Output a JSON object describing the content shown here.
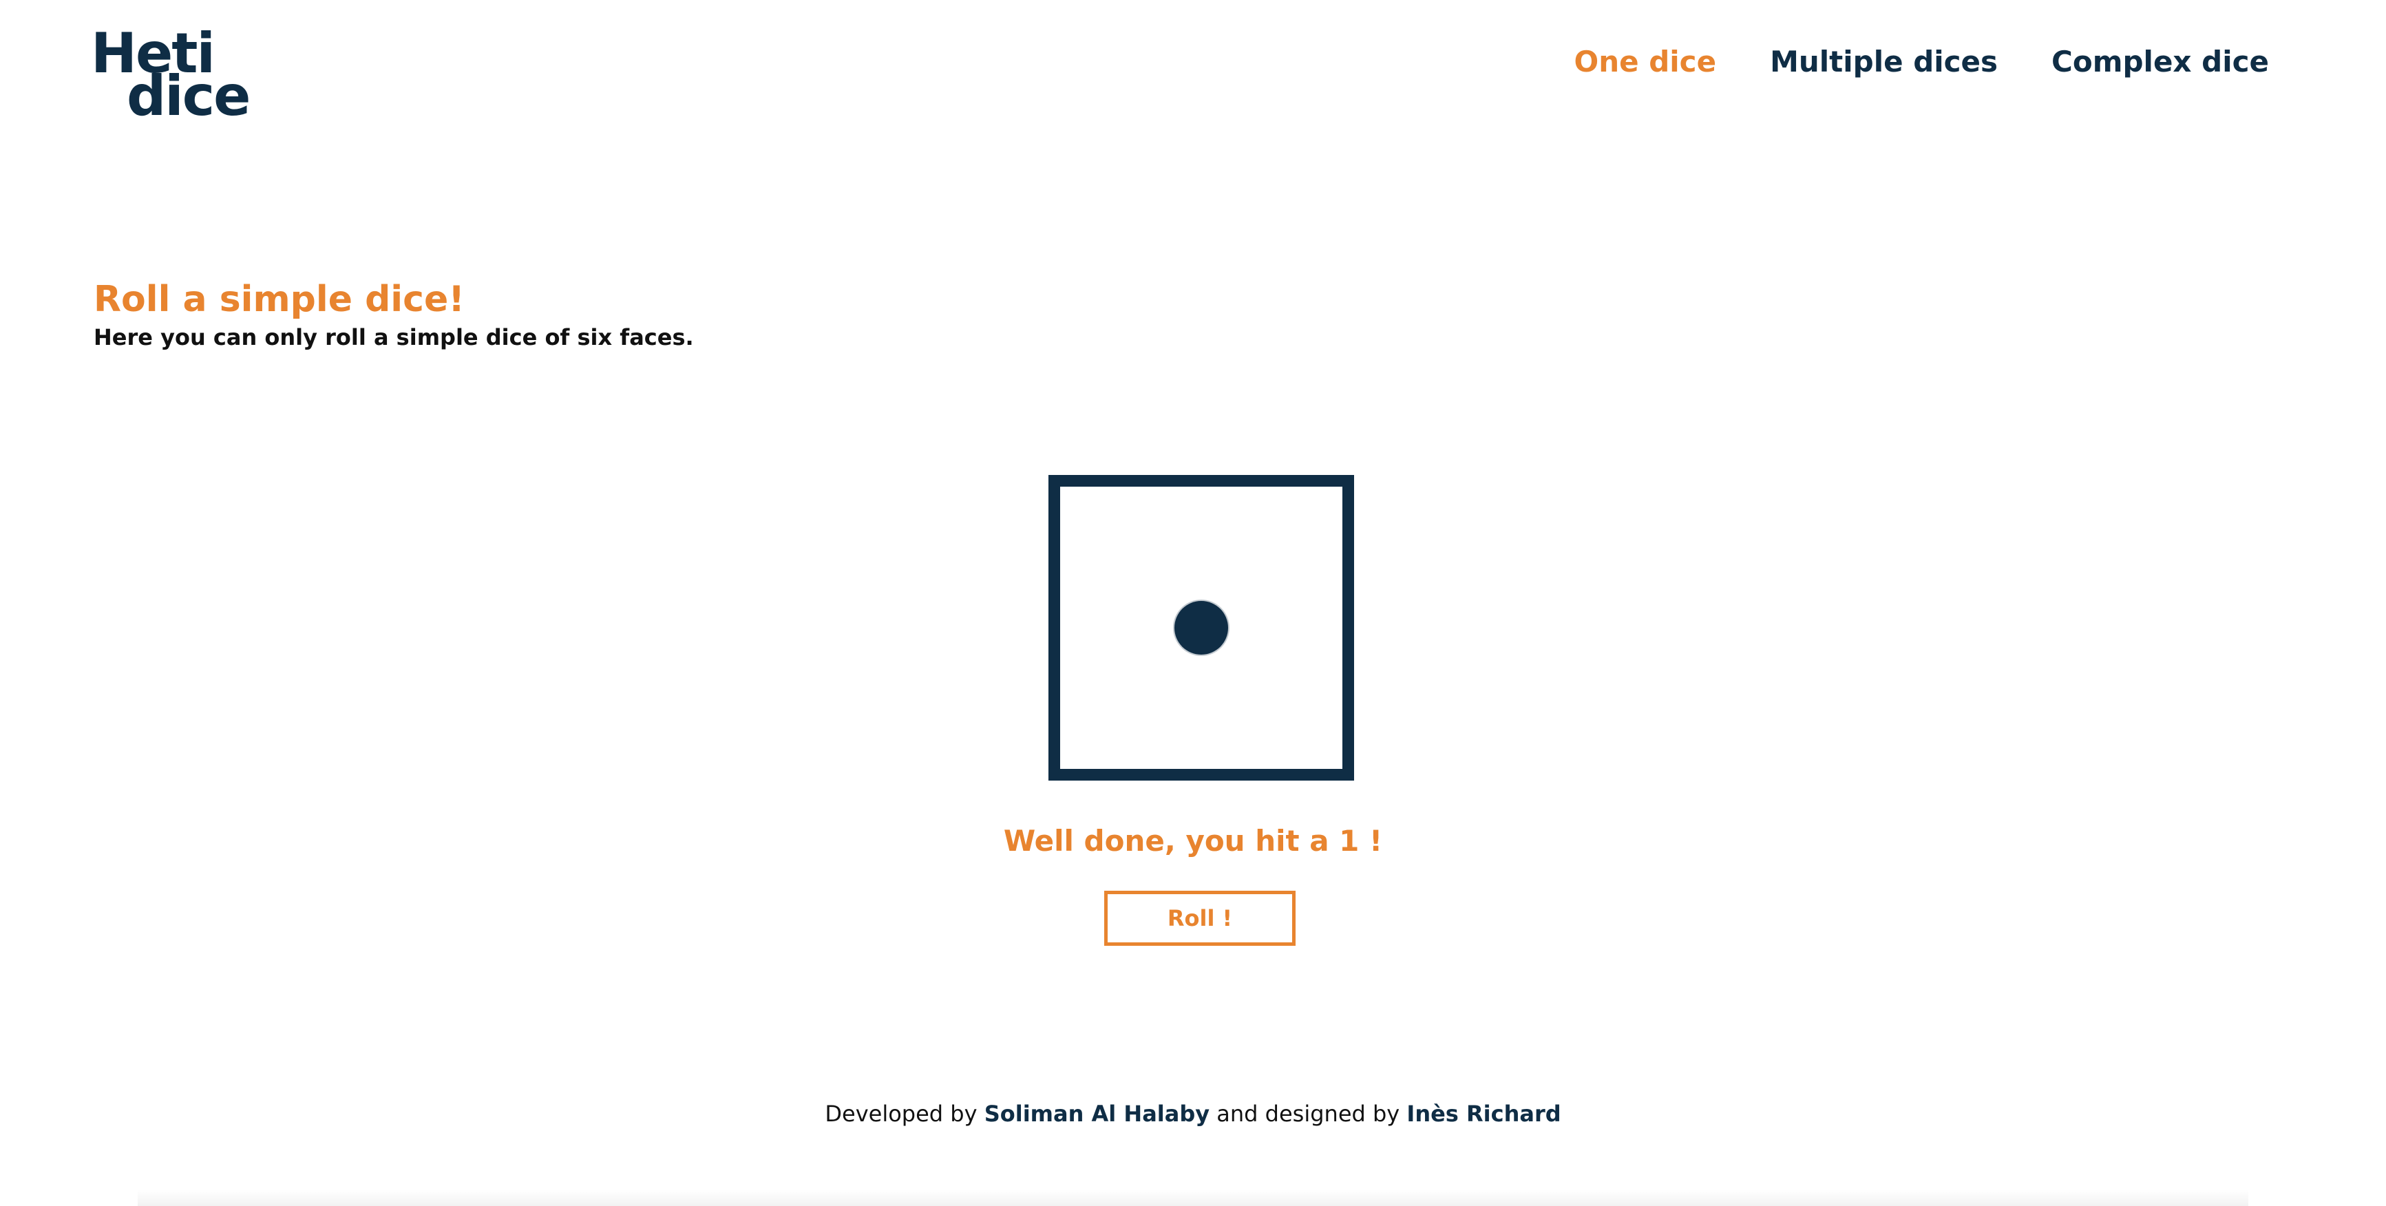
{
  "logo": {
    "line1": "Heti",
    "line2": "dice"
  },
  "nav": {
    "items": [
      {
        "label": "One dice",
        "active": true
      },
      {
        "label": "Multiple dices",
        "active": false
      },
      {
        "label": "Complex dice",
        "active": false
      }
    ]
  },
  "intro": {
    "title": "Roll a simple dice!",
    "text": "Here you can only roll a simple dice of six faces."
  },
  "dice": {
    "value": 1
  },
  "result": {
    "message": "Well done, you hit a 1 !"
  },
  "roll_button": {
    "label": "Roll !"
  },
  "footer": {
    "developed_by": "Developed by",
    "developer": "Soliman Al Halaby",
    "designed_by": "and designed by",
    "designer": "Inès Richard"
  },
  "colors": {
    "primary": "#0f2d45",
    "accent": "#e8842f"
  }
}
